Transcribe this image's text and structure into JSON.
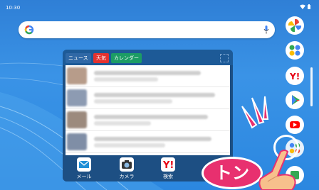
{
  "status": {
    "time": "10:30"
  },
  "widget": {
    "tabs": [
      "ニュース",
      "天気",
      "カレンダー"
    ],
    "apps": [
      "メール",
      "カメラ",
      "検索"
    ]
  },
  "overlay": {
    "tap_label": "トン"
  },
  "colors": {
    "accent_pink": "#e8306f",
    "widget_blue": "#1d4f83"
  },
  "dock": {
    "icons": [
      "pinwheel-icon",
      "apps-folder-icon",
      "yahoo-icon",
      "play-store-icon",
      "youtube-icon",
      "app-folder-icon"
    ]
  }
}
